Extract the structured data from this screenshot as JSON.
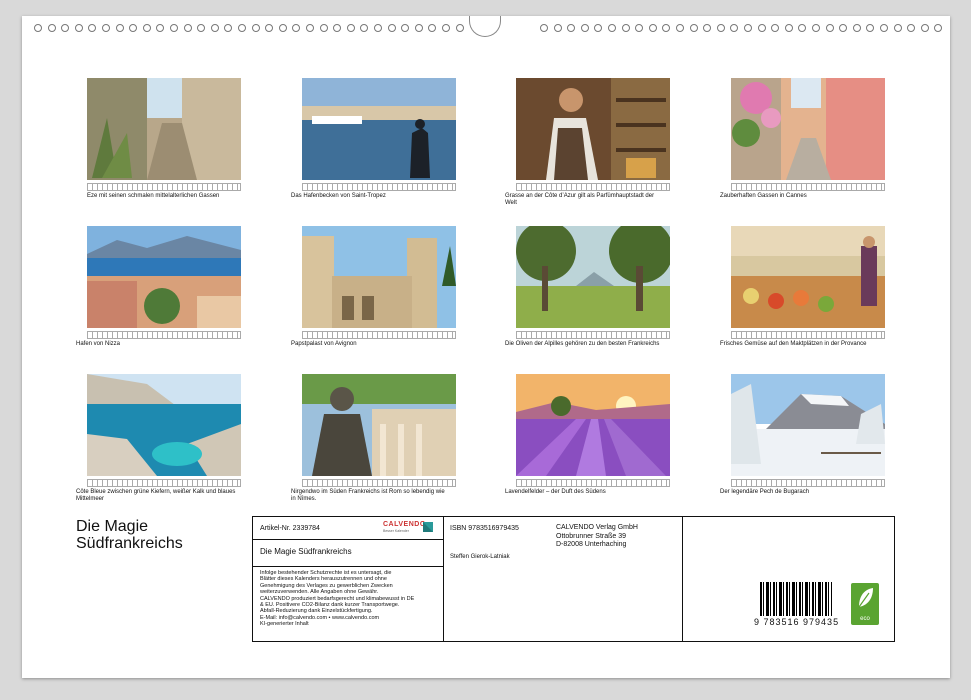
{
  "photos": [
    {
      "caption": "Eze mit seinen schmalen mittelalterlichen Gassen"
    },
    {
      "caption": "Das Hafenbecken von Saint-Tropez"
    },
    {
      "caption": "Grasse an der Côte d’Azur gilt als Parfümhauptstadt der Welt"
    },
    {
      "caption": "Zauberhaften Gassen in Cannes"
    },
    {
      "caption": "Hafen von Nizza"
    },
    {
      "caption": "Papstpalast von Avignon"
    },
    {
      "caption": "Die Oliven der Alpilles gehören zu den besten Frankreichs"
    },
    {
      "caption": "Frisches Gemüse auf den Maktplätzen in der Provance"
    },
    {
      "caption": " Côte Bleue zwischen grüne Kiefern, weißer Kalk und blaues Mittelmeer"
    },
    {
      "caption": "Nirgendwo im Süden Frankreichs ist Rom so lebendig wie in Nîmes."
    },
    {
      "caption": "Lavendelfelder – der Duft des Südens"
    },
    {
      "caption": "Der legendäre Pech de Bugarach"
    }
  ],
  "title_line1": "Die Magie",
  "title_line2": "Südfrankreichs",
  "info": {
    "article": "Artikel-Nr. 2339784",
    "logo": "CALVENDO",
    "logo_sub": "Besser Kalender",
    "calendar_title": "Die Magie Südfrankreichs",
    "isbn": "ISBN 9783516979435",
    "author": "Steffen Gierok-Latniak",
    "publisher_line1": "CALVENDO Verlag GmbH",
    "publisher_line2": "Ottobrunner Straße 39",
    "publisher_line3": "D-82008 Unterhaching",
    "legal": [
      "Infolge bestehender Schutzrechte ist es untersagt, die",
      "Blätter dieses Kalenders herauszutrennen und ohne",
      "Genehmigung des Verlages zu gewerblichen Zwecken",
      "weiterzuverwenden. Alle Angaben ohne Gewähr.",
      "CALVENDO produziert bedarfsgerecht und klimabewusst in DE",
      "& EU. Positivere CO2-Bilanz dank kurzer Transportwege.",
      "Abfall-Reduzierung dank Einzelstückfertigung.",
      "E-Mail: info@calvendo.com • www.calvendo.com",
      "KI-generierter Inhalt"
    ],
    "barcode_text": "9 783516 979435",
    "eco_label": "eco"
  },
  "colors": {
    "eco_green": "#5aa431",
    "logo_red": "#cc3333"
  }
}
